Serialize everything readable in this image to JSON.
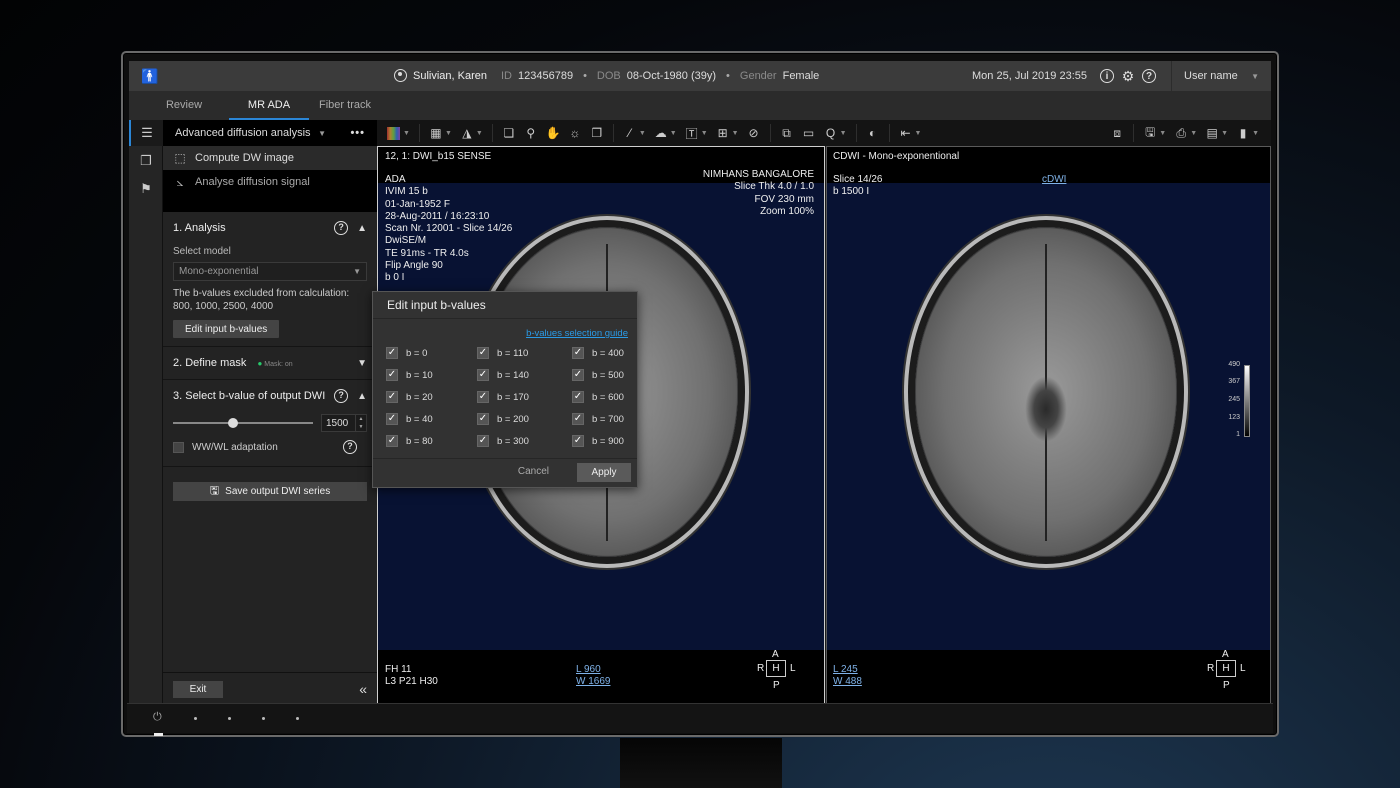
{
  "header": {
    "patient_name": "Sulivian, Karen",
    "id_label": "ID",
    "id_value": "123456789",
    "dob_label": "DOB",
    "dob_value": "08-Oct-1980 (39y)",
    "gender_label": "Gender",
    "gender_value": "Female",
    "datetime": "Mon 25, Jul 2019  23:55",
    "user_name": "User name"
  },
  "tabs": [
    {
      "label": "Review",
      "active": false
    },
    {
      "label": "MR ADA",
      "active": true
    },
    {
      "label": "Fiber track",
      "active": false
    }
  ],
  "panel": {
    "title": "Advanced diffusion analysis",
    "more": "•••",
    "steps": [
      {
        "label": "Compute DW image",
        "icon": "compute-image-icon",
        "active": true
      },
      {
        "label": "Analyse diffusion signal",
        "icon": "signal-curve-icon",
        "active": false
      }
    ],
    "analysis": {
      "title": "1. Analysis",
      "select_model_label": "Select model",
      "model_value": "Mono-exponential",
      "excluded_note": "The b-values excluded from calculation:",
      "excluded_values": "800, 1000,  2500, 4000",
      "edit_button": "Edit input b-values"
    },
    "mask": {
      "title": "2. Define mask",
      "status": "Mask: on",
      "status_color": "#27c96b"
    },
    "output": {
      "title": "3. Select b-value of output DWI",
      "b_value": "1500",
      "slider_fraction": 0.42,
      "wwwl_label": "WW/WL adaptation",
      "wwwl_checked": false,
      "save_button": "Save output DWI series"
    },
    "exit_button": "Exit"
  },
  "viewport1": {
    "series_title": "12, 1: DWI_b15 SENSE",
    "left_info": [
      "ADA",
      "IVIM 15 b",
      "01-Jan-1952 F",
      "28-Aug-2011 / 16:23:10",
      "Scan Nr. 12001 - Slice 14/26",
      "DwiSE/M",
      "TE 91ms - TR 4.0s",
      "Flip Angle 90",
      "b 0 I"
    ],
    "right_info": [
      "NIMHANS BANGALORE",
      "Slice Thk 4.0 / 1.0",
      "FOV 230 mm",
      "Zoom 100%"
    ],
    "bottom_left": [
      "FH 11",
      "L3 P21 H30"
    ],
    "level": "L 960",
    "window": "W 1669",
    "orientation": {
      "top": "A",
      "bottom": "P",
      "left": "R",
      "right": "L",
      "center": "H"
    }
  },
  "viewport2": {
    "series_title": "CDWI - Mono-exponentional",
    "left_info": [
      "Slice 14/26",
      "b 1500 I"
    ],
    "center_link": "cDWI",
    "level": "L 245",
    "window": "W 488",
    "colorbar_ticks": [
      "490",
      "367",
      "245",
      "123",
      "1"
    ],
    "orientation": {
      "top": "A",
      "bottom": "P",
      "left": "R",
      "right": "L",
      "center": "H"
    }
  },
  "dialog": {
    "title": "Edit input b-values",
    "guide_link": "b-values selection guide",
    "b_values": [
      {
        "label": "b = 0",
        "checked": true
      },
      {
        "label": "b = 10",
        "checked": true
      },
      {
        "label": "b = 20",
        "checked": true
      },
      {
        "label": "b = 40",
        "checked": true
      },
      {
        "label": "b = 80",
        "checked": true
      },
      {
        "label": "b = 110",
        "checked": true
      },
      {
        "label": "b = 140",
        "checked": true
      },
      {
        "label": "b = 170",
        "checked": true
      },
      {
        "label": "b = 200",
        "checked": true
      },
      {
        "label": "b = 300",
        "checked": true
      },
      {
        "label": "b = 400",
        "checked": true
      },
      {
        "label": "b = 500",
        "checked": true
      },
      {
        "label": "b = 600",
        "checked": true
      },
      {
        "label": "b = 700",
        "checked": true
      },
      {
        "label": "b = 900",
        "checked": true
      }
    ],
    "cancel": "Cancel",
    "apply": "Apply"
  },
  "icons": {
    "check": "✓",
    "chevron_up": "︿",
    "chevron_down": "﹀",
    "collapse": "«",
    "help": "?",
    "info": "i",
    "power": "⏻"
  }
}
